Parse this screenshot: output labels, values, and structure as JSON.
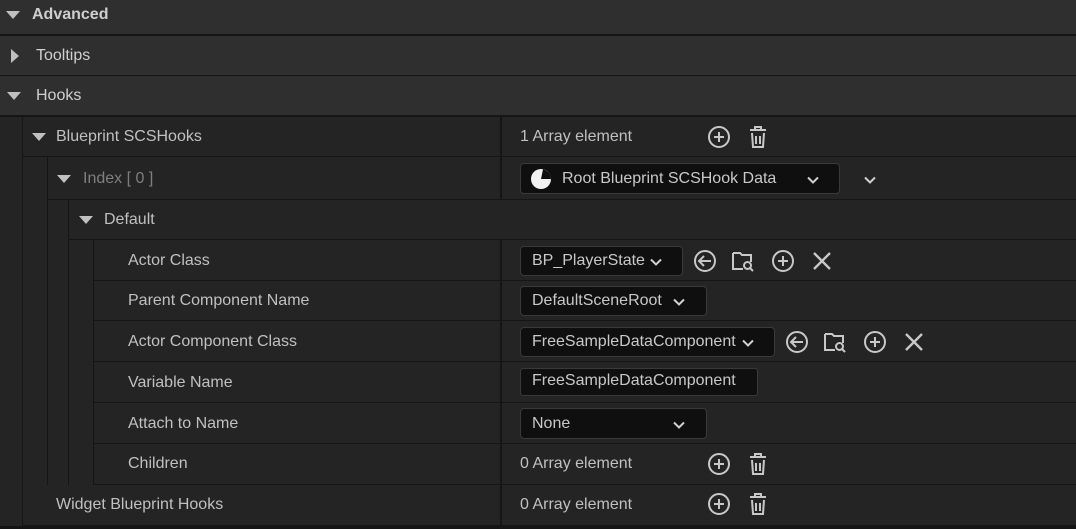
{
  "sections": {
    "advanced": "Advanced",
    "tooltips": "Tooltips",
    "hooks": "Hooks"
  },
  "blueprint_scs_hooks": {
    "label": "Blueprint SCSHooks",
    "count": "1 Array element",
    "index": {
      "label": "Index",
      "bracket_text": "[ 0 ]",
      "type_combo": "Root Blueprint SCSHook Data"
    },
    "default_label": "Default",
    "properties": {
      "actor_class": {
        "label": "Actor Class",
        "value": "BP_PlayerState"
      },
      "parent_component_name": {
        "label": "Parent Component Name",
        "value": "DefaultSceneRoot"
      },
      "actor_component_class": {
        "label": "Actor Component Class",
        "value": "FreeSampleDataComponent"
      },
      "variable_name": {
        "label": "Variable Name",
        "value": "FreeSampleDataComponent"
      },
      "attach_to_name": {
        "label": "Attach to Name",
        "value": "None"
      },
      "children": {
        "label": "Children",
        "count": "0 Array element"
      }
    }
  },
  "widget_blueprint_hooks": {
    "label": "Widget Blueprint Hooks",
    "count": "0 Array element"
  },
  "icons": [
    "add-element-icon",
    "delete-all-icon",
    "use-selected-icon",
    "browse-icon",
    "add-icon",
    "clear-icon",
    "chevron-down-icon",
    "expand-arrow-icon",
    "collapse-arrow-icon",
    "blueprint-class-icon"
  ],
  "colors": {
    "background": "#242424",
    "category_background": "#2f2f2f",
    "input_background": "#0f0f0f",
    "text": "#c0c0c0",
    "muted_text": "#7f7f7f"
  }
}
